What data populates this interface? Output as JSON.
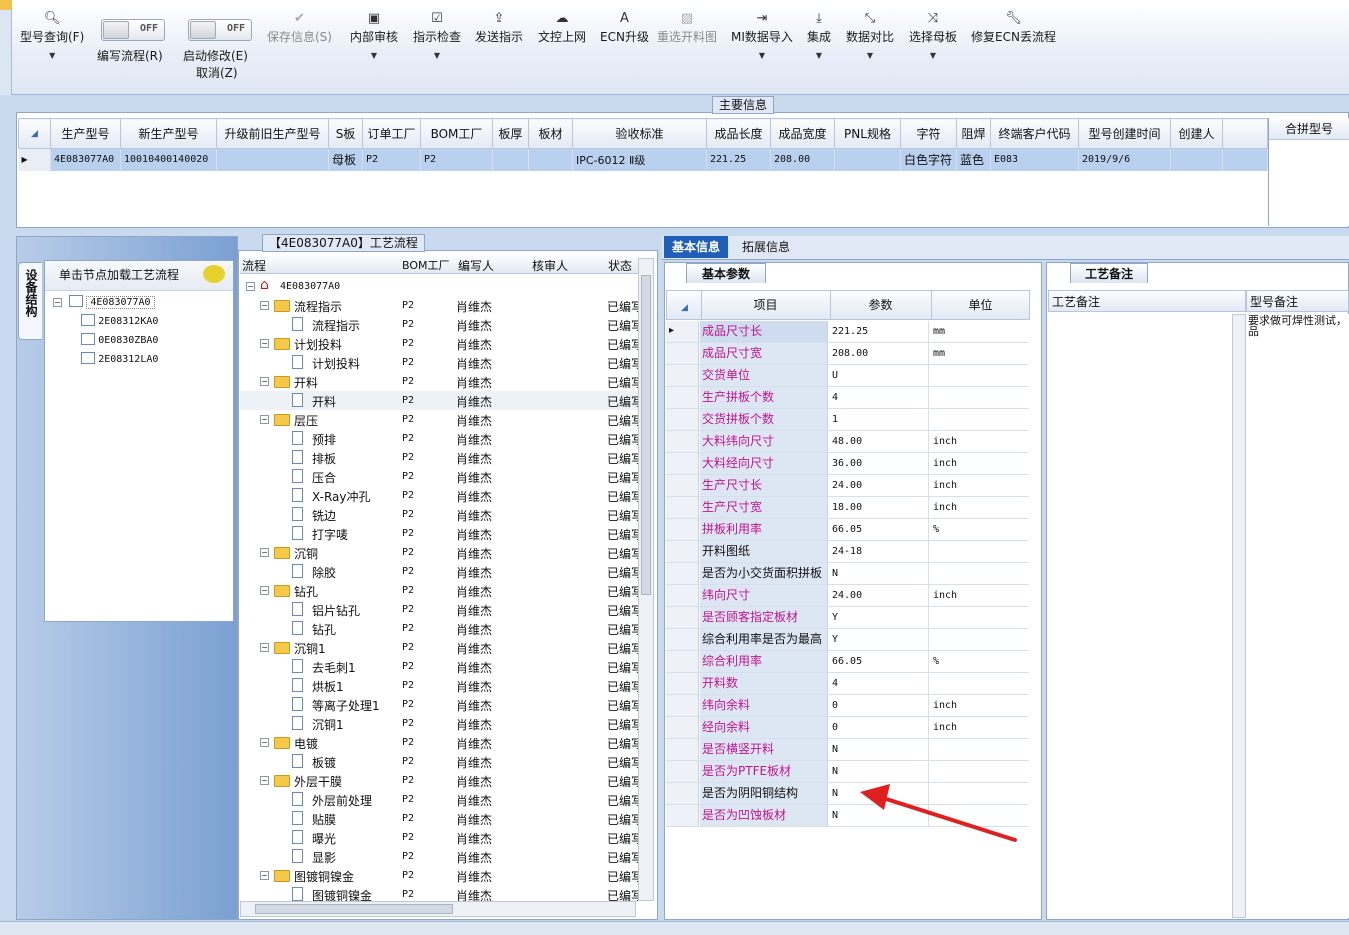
{
  "toolbar": {
    "query": "型号查询(F)",
    "toggle_off": "OFF",
    "write_flow": "编写流程(R)",
    "enable_edit": "启动修改(E)",
    "cancel": "取消(Z)",
    "save": "保存信息(S)",
    "internal_review": "内部审核",
    "instruction_check": "指示检查",
    "send_instruction": "发送指示",
    "doc_upload": "文控上网",
    "ecn_upgrade": "ECN升级",
    "reselect_cut": "重选开料图",
    "mi_import": "MI数据导入",
    "integrate": "集成",
    "data_compare": "数据对比",
    "select_master": "选择母板",
    "fix_ecn": "修复ECN丢流程"
  },
  "main_info": {
    "label": "主要信息",
    "columns": [
      "生产型号",
      "新生产型号",
      "升级前旧生产型号",
      "S板",
      "订单工厂",
      "BOM工厂",
      "板厚",
      "板材",
      "验收标准",
      "成品长度",
      "成品宽度",
      "PNL规格",
      "字符",
      "阻焊",
      "终端客户代码",
      "型号创建时间",
      "创建人"
    ],
    "row": {
      "prod_model": "4E083077A0",
      "new_model": "10010400140020",
      "s_board": "母板",
      "order_factory": "P2",
      "bom_factory": "P2",
      "standard": "IPC-6012 Ⅱ级",
      "length": "221.25",
      "width": "208.00",
      "char": "白色字符",
      "mask": "蓝色",
      "customer": "E083",
      "created": "2019/9/6"
    },
    "merge_header": "合拼型号"
  },
  "left_panel": {
    "vertical_tab": "设备结构",
    "hint": "单击节点加载工艺流程",
    "tree": [
      "4E083077A0",
      "2E08312KA0",
      "0E0830ZBA0",
      "2E08312LA0"
    ]
  },
  "flow": {
    "label": "【4E083077A0】工艺流程",
    "columns": [
      "流程",
      "BOM工厂",
      "编写人",
      "核审人",
      "状态"
    ],
    "rows": [
      {
        "name": "4E083077A0",
        "level": 0,
        "type": "root",
        "bom": "",
        "writer": "",
        "status": ""
      },
      {
        "name": "流程指示",
        "level": 1,
        "type": "folder",
        "bom": "P2",
        "writer": "肖维杰",
        "status": "已编写"
      },
      {
        "name": "流程指示",
        "level": 2,
        "type": "doc",
        "bom": "P2",
        "writer": "肖维杰",
        "status": "已编写"
      },
      {
        "name": "计划投料",
        "level": 1,
        "type": "folder",
        "bom": "P2",
        "writer": "肖维杰",
        "status": "已编写"
      },
      {
        "name": "计划投料",
        "level": 2,
        "type": "doc",
        "bom": "P2",
        "writer": "肖维杰",
        "status": "已编写"
      },
      {
        "name": "开料",
        "level": 1,
        "type": "folder",
        "bom": "P2",
        "writer": "肖维杰",
        "status": "已编写"
      },
      {
        "name": "开料",
        "level": 2,
        "type": "doc",
        "bom": "P2",
        "writer": "肖维杰",
        "status": "已编写",
        "selected": true
      },
      {
        "name": "层压",
        "level": 1,
        "type": "folder",
        "bom": "P2",
        "writer": "肖维杰",
        "status": "已编写"
      },
      {
        "name": "预排",
        "level": 2,
        "type": "doc",
        "bom": "P2",
        "writer": "肖维杰",
        "status": "已编写"
      },
      {
        "name": "排板",
        "level": 2,
        "type": "doc",
        "bom": "P2",
        "writer": "肖维杰",
        "status": "已编写"
      },
      {
        "name": "压合",
        "level": 2,
        "type": "doc",
        "bom": "P2",
        "writer": "肖维杰",
        "status": "已编写"
      },
      {
        "name": "X-Ray冲孔",
        "level": 2,
        "type": "doc",
        "bom": "P2",
        "writer": "肖维杰",
        "status": "已编写"
      },
      {
        "name": "铣边",
        "level": 2,
        "type": "doc",
        "bom": "P2",
        "writer": "肖维杰",
        "status": "已编写"
      },
      {
        "name": "打字唛",
        "level": 2,
        "type": "doc",
        "bom": "P2",
        "writer": "肖维杰",
        "status": "已编写"
      },
      {
        "name": "沉铜",
        "level": 1,
        "type": "folder",
        "bom": "P2",
        "writer": "肖维杰",
        "status": "已编写"
      },
      {
        "name": "除胶",
        "level": 2,
        "type": "doc",
        "bom": "P2",
        "writer": "肖维杰",
        "status": "已编写"
      },
      {
        "name": "钻孔",
        "level": 1,
        "type": "folder",
        "bom": "P2",
        "writer": "肖维杰",
        "status": "已编写"
      },
      {
        "name": "铝片钻孔",
        "level": 2,
        "type": "doc",
        "bom": "P2",
        "writer": "肖维杰",
        "status": "已编写"
      },
      {
        "name": "钻孔",
        "level": 2,
        "type": "doc",
        "bom": "P2",
        "writer": "肖维杰",
        "status": "已编写"
      },
      {
        "name": "沉铜1",
        "level": 1,
        "type": "folder",
        "bom": "P2",
        "writer": "肖维杰",
        "status": "已编写"
      },
      {
        "name": "去毛刺1",
        "level": 2,
        "type": "doc",
        "bom": "P2",
        "writer": "肖维杰",
        "status": "已编写"
      },
      {
        "name": "烘板1",
        "level": 2,
        "type": "doc",
        "bom": "P2",
        "writer": "肖维杰",
        "status": "已编写"
      },
      {
        "name": "等离子处理1",
        "level": 2,
        "type": "doc",
        "bom": "P2",
        "writer": "肖维杰",
        "status": "已编写"
      },
      {
        "name": "沉铜1",
        "level": 2,
        "type": "doc",
        "bom": "P2",
        "writer": "肖维杰",
        "status": "已编写"
      },
      {
        "name": "电镀",
        "level": 1,
        "type": "folder",
        "bom": "P2",
        "writer": "肖维杰",
        "status": "已编写"
      },
      {
        "name": "板镀",
        "level": 2,
        "type": "doc",
        "bom": "P2",
        "writer": "肖维杰",
        "status": "已编写"
      },
      {
        "name": "外层干膜",
        "level": 1,
        "type": "folder",
        "bom": "P2",
        "writer": "肖维杰",
        "status": "已编写"
      },
      {
        "name": "外层前处理",
        "level": 2,
        "type": "doc",
        "bom": "P2",
        "writer": "肖维杰",
        "status": "已编写"
      },
      {
        "name": "贴膜",
        "level": 2,
        "type": "doc",
        "bom": "P2",
        "writer": "肖维杰",
        "status": "已编写"
      },
      {
        "name": "曝光",
        "level": 2,
        "type": "doc",
        "bom": "P2",
        "writer": "肖维杰",
        "status": "已编写"
      },
      {
        "name": "显影",
        "level": 2,
        "type": "doc",
        "bom": "P2",
        "writer": "肖维杰",
        "status": "已编写"
      },
      {
        "name": "图镀铜镍金",
        "level": 1,
        "type": "folder",
        "bom": "P2",
        "writer": "肖维杰",
        "status": "已编写"
      },
      {
        "name": "图镀铜镍金",
        "level": 2,
        "type": "doc",
        "bom": "P2",
        "writer": "肖维杰",
        "status": "已编写"
      }
    ]
  },
  "tabs": {
    "basic": "基本信息",
    "extended": "拓展信息",
    "basic_params": "基本参数",
    "process_notes_tab": "工艺备注"
  },
  "params": {
    "columns": [
      "项目",
      "参数",
      "单位"
    ],
    "rows": [
      {
        "name": "成品尺寸长",
        "value": "221.25",
        "unit": "mm",
        "pink": true,
        "current": true
      },
      {
        "name": "成品尺寸宽",
        "value": "208.00",
        "unit": "mm",
        "pink": true
      },
      {
        "name": "交货单位",
        "value": "U",
        "unit": "",
        "pink": true
      },
      {
        "name": "生产拼板个数",
        "value": "4",
        "unit": "",
        "pink": true
      },
      {
        "name": "交货拼板个数",
        "value": "1",
        "unit": "",
        "pink": true
      },
      {
        "name": "大料纬向尺寸",
        "value": "48.00",
        "unit": "inch",
        "pink": true
      },
      {
        "name": "大料经向尺寸",
        "value": "36.00",
        "unit": "inch",
        "pink": true
      },
      {
        "name": "生产尺寸长",
        "value": "24.00",
        "unit": "inch",
        "pink": true
      },
      {
        "name": "生产尺寸宽",
        "value": "18.00",
        "unit": "inch",
        "pink": true
      },
      {
        "name": "拼板利用率",
        "value": "66.05",
        "unit": "%",
        "pink": true
      },
      {
        "name": "开料图纸",
        "value": "24-18",
        "unit": "",
        "pink": false
      },
      {
        "name": "是否为小交货面积拼板",
        "value": "N",
        "unit": "",
        "pink": false
      },
      {
        "name": "纬向尺寸",
        "value": "24.00",
        "unit": "inch",
        "pink": true
      },
      {
        "name": "是否顾客指定板材",
        "value": "Y",
        "unit": "",
        "pink": true
      },
      {
        "name": "综合利用率是否为最高",
        "value": "Y",
        "unit": "",
        "pink": false
      },
      {
        "name": "综合利用率",
        "value": "66.05",
        "unit": "%",
        "pink": true
      },
      {
        "name": "开料数",
        "value": "4",
        "unit": "",
        "pink": true
      },
      {
        "name": "纬向余料",
        "value": "0",
        "unit": "inch",
        "pink": true
      },
      {
        "name": "经向余料",
        "value": "0",
        "unit": "inch",
        "pink": true
      },
      {
        "name": "是否横竖开料",
        "value": "N",
        "unit": "",
        "pink": true
      },
      {
        "name": "是否为PTFE板材",
        "value": "N",
        "unit": "",
        "pink": true
      },
      {
        "name": "是否为阴阳铜结构",
        "value": "N",
        "unit": "",
        "pink": false
      },
      {
        "name": "是否为凹蚀板材",
        "value": "N",
        "unit": "",
        "pink": true
      }
    ]
  },
  "notes": {
    "process_header": "工艺备注",
    "model_header": "型号备注",
    "model_note": "要求做可焊性测试，品"
  },
  "colors": {
    "pink": "#c0148c",
    "accent": "#1f5fb8",
    "arrow": "#e02020"
  }
}
